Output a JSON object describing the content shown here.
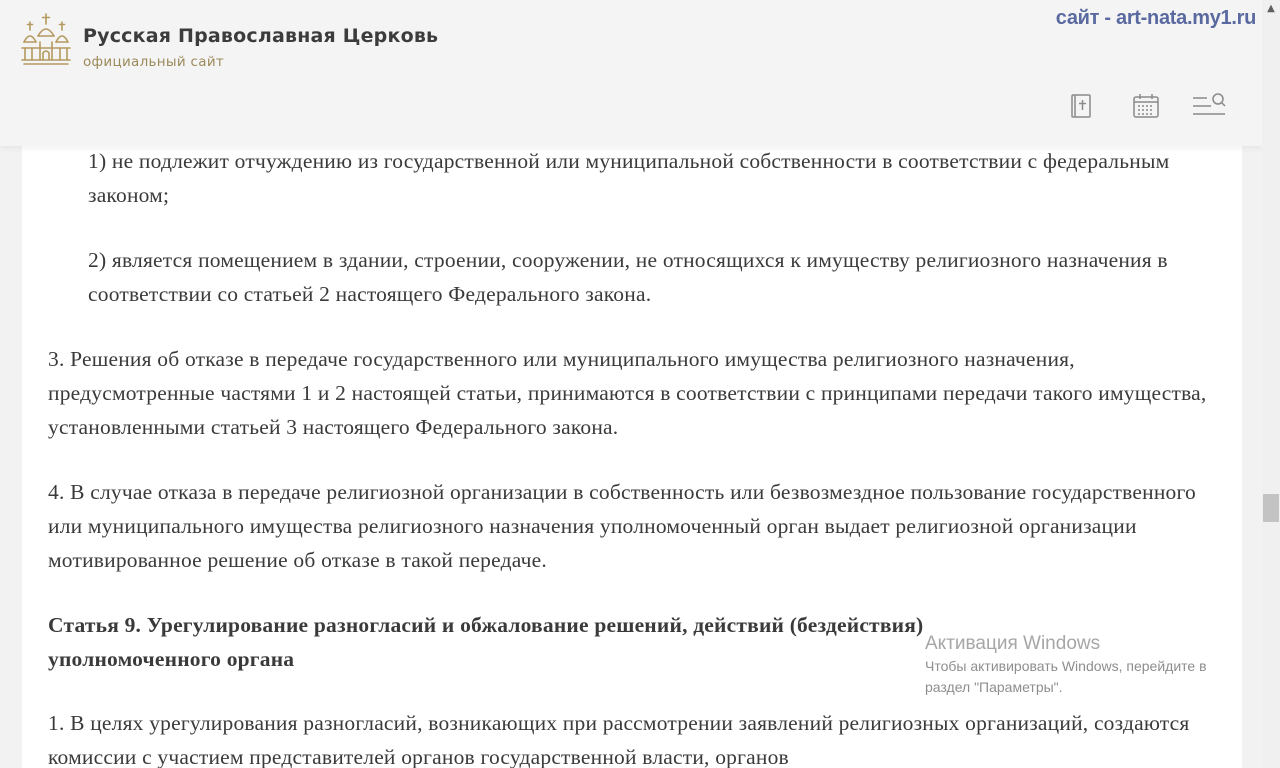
{
  "header": {
    "site_title": "Русская Православная Церковь",
    "site_subtitle": "официальный сайт",
    "watermark": "сайт  - art-nata.my1.ru",
    "icons": [
      "bible-icon",
      "calendar-icon",
      "menu-search-icon"
    ]
  },
  "article": {
    "item_1": "1) не подлежит отчуждению из государственной или муниципальной собственности в соответствии с федеральным законом;",
    "item_2": "2) является помещением в здании, строении, сооружении, не относящихся к имуществу религиозного назначения в соответствии со статьей 2 настоящего Федерального закона.",
    "para_3": "3. Решения об отказе в передаче государственного или муниципального имущества религиозного назначения, предусмотренные частями 1 и 2 настоящей статьи, принимаются в соответствии с принципами передачи такого имущества, установленными статьей 3 настоящего Федерального закона.",
    "para_4": "4. В случае отказа в передаче религиозной организации в собственность или безвозмездное пользование государственного или муниципального имущества религиозного назначения уполномоченный орган выдает религиозной организации мотивированное решение об отказе в такой передаче.",
    "article_9_heading": "Статья 9. Урегулирование разногласий и обжалование решений, действий (бездействия) уполномоченного органа",
    "article_9_para_1": "1. В целях урегулирования разногласий, возникающих при рассмотрении заявлений религиозных организаций, создаются комиссии с участием представителей органов государственной власти, органов"
  },
  "windows_activation": {
    "title": "Активация Windows",
    "text": "Чтобы активировать Windows, перейдите в раздел \"Параметры\"."
  },
  "colors": {
    "text": "#3a3a3a",
    "gold": "#b49a5e",
    "watermark": "#5a6aa0"
  }
}
